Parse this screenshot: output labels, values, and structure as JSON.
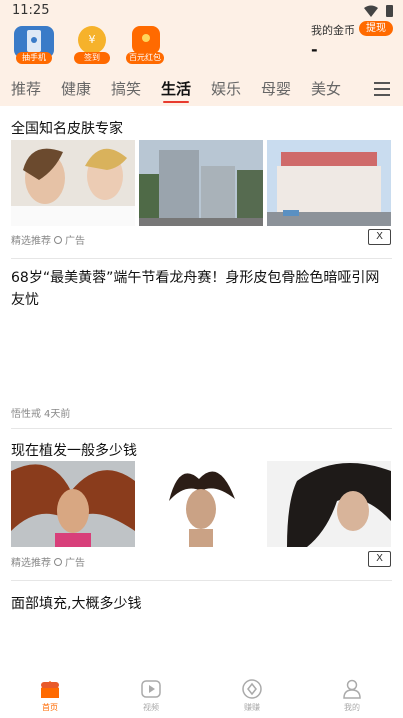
{
  "status": {
    "time": "11:25"
  },
  "rewards": [
    {
      "icon": "phone-lock-icon",
      "label": "抽手机"
    },
    {
      "icon": "coin-icon",
      "glyph": "¥",
      "label": "签到"
    },
    {
      "icon": "red-packet-icon",
      "label": "百元红包"
    }
  ],
  "wallet": {
    "coin_label": "我的金币",
    "withdraw_label": "提现",
    "coin_value": "-"
  },
  "tabs": [
    "推荐",
    "健康",
    "搞笑",
    "生活",
    "娱乐",
    "母婴",
    "美女"
  ],
  "active_tab": "生活",
  "feed": [
    {
      "title": "全国知名皮肤专家",
      "source": "精选推荐",
      "ad_label": "广告",
      "close_label": "X",
      "images": [
        "women-skincare-photo",
        "hospital-buildings-photo",
        "hospital-campus-photo"
      ]
    },
    {
      "title": "68岁“最美黄蓉”端午节看龙舟赛！身形皮包骨脸色暗哑引网友忧",
      "source": "悟性戒",
      "time": "4天前"
    },
    {
      "title": "现在植发一般多少钱",
      "source": "精选推荐",
      "ad_label": "广告",
      "close_label": "X",
      "images": [
        "woman-flowing-hair-photo",
        "woman-hair-up-photo",
        "woman-hair-blowing-photo"
      ]
    },
    {
      "title": "面部填充,大概多少钱"
    }
  ],
  "bottom_nav": [
    {
      "icon": "home-icon",
      "label": "首页"
    },
    {
      "icon": "video-icon",
      "label": "视频"
    },
    {
      "icon": "earn-icon",
      "label": "赚赚"
    },
    {
      "icon": "profile-icon",
      "label": "我的"
    }
  ],
  "colors": {
    "accent": "#ff6a00",
    "tab_underline": "#e83a2d",
    "header_bg": "#fdf0e6"
  }
}
